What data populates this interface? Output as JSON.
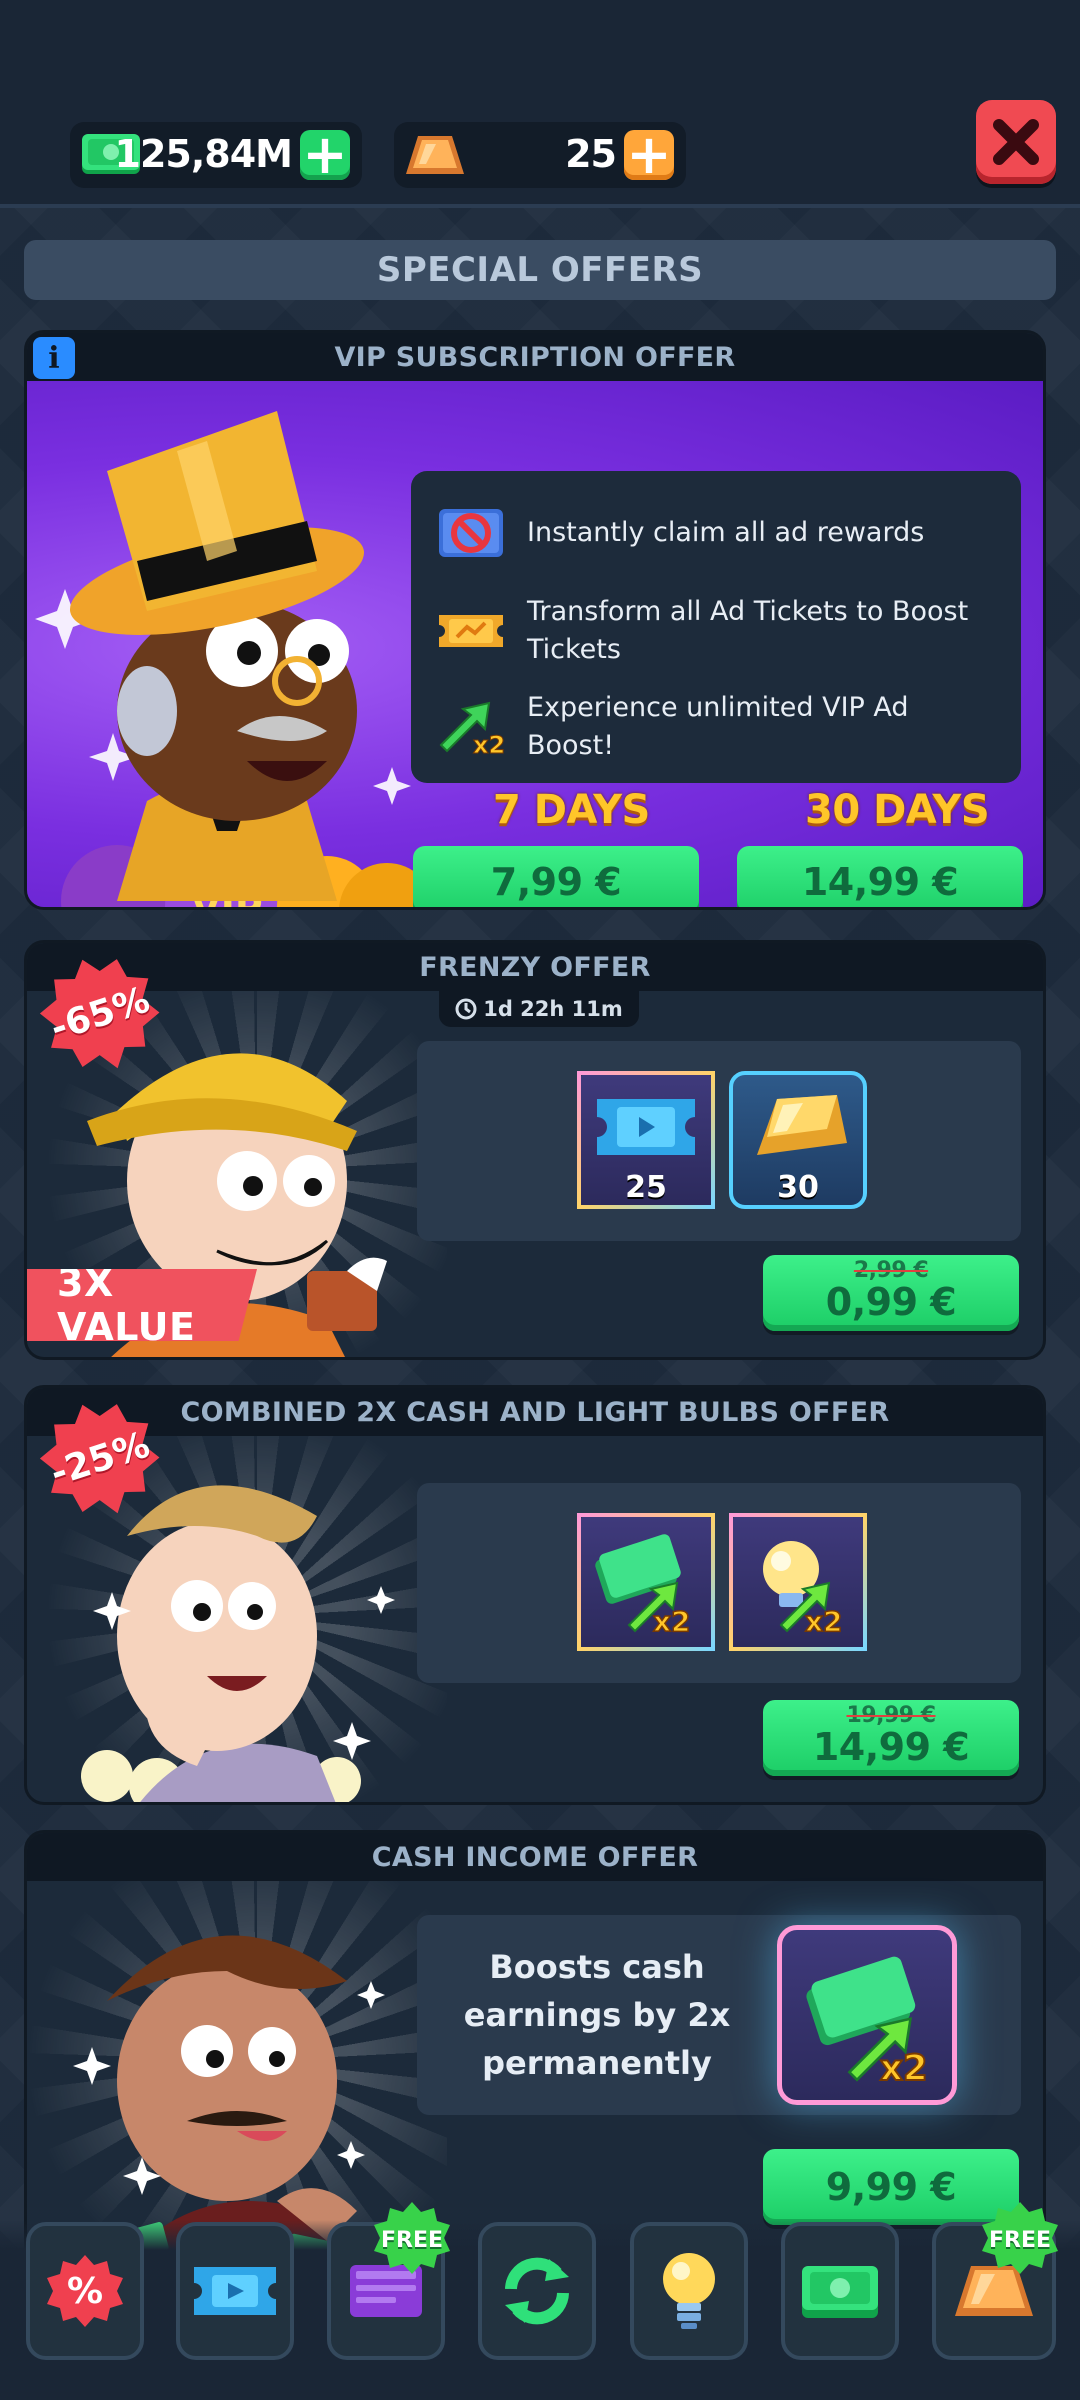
{
  "topbar": {
    "cash_amount": "125,84M",
    "gold_amount": "25"
  },
  "header": {
    "title": "SPECIAL OFFERS"
  },
  "vip": {
    "title": "VIP SUBSCRIPTION OFFER",
    "features": [
      {
        "icon": "no-ads-icon",
        "text": "Instantly claim all ad rewards"
      },
      {
        "icon": "ticket-icon",
        "text": "Transform all Ad Tickets to Boost Tickets"
      },
      {
        "icon": "boost-x2-icon",
        "text": "Experience unlimited VIP Ad Boost!"
      }
    ],
    "plans": [
      {
        "label": "7 DAYS",
        "price": "7,99 €"
      },
      {
        "label": "30 DAYS",
        "price": "14,99 €"
      }
    ],
    "hat_badge": "VIP"
  },
  "frenzy": {
    "title": "FRENZY OFFER",
    "timer": "1d 22h 11m",
    "discount": "-65%",
    "value_banner": "3X VALUE",
    "items": [
      {
        "icon": "boost-ticket-icon",
        "qty": "25"
      },
      {
        "icon": "gold-bar-icon",
        "qty": "30"
      }
    ],
    "old_price": "2,99 €",
    "price": "0,99 €"
  },
  "combined": {
    "title": "COMBINED 2X CASH AND LIGHT BULBS OFFER",
    "discount": "-25%",
    "items": [
      {
        "icon": "cash-x2-icon",
        "badge": "x2"
      },
      {
        "icon": "bulb-x2-icon",
        "badge": "x2"
      }
    ],
    "old_price": "19,99 €",
    "price": "14,99 €"
  },
  "cash_income": {
    "title": "CASH INCOME OFFER",
    "description": "Boosts cash earnings by 2x permanently",
    "item_badge": "x2",
    "price": "9,99 €"
  },
  "bottom_nav": {
    "items": [
      {
        "icon": "percent-icon"
      },
      {
        "icon": "ticket-icon"
      },
      {
        "icon": "boost-card-icon",
        "badge": "FREE"
      },
      {
        "icon": "refresh-icon"
      },
      {
        "icon": "lightbulb-icon"
      },
      {
        "icon": "cash-icon"
      },
      {
        "icon": "gold-bar-icon",
        "badge": "FREE"
      }
    ]
  },
  "colors": {
    "background": "#1e2c3d",
    "accent_green": "#22d46a",
    "vip_purple": "#7a2fe0",
    "gold": "#ffc629",
    "close_red": "#f04a52"
  }
}
